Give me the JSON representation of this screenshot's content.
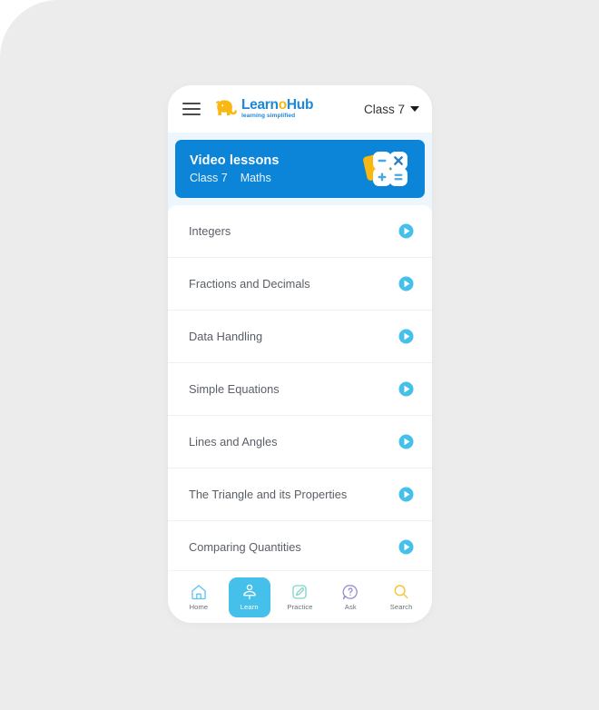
{
  "app": {
    "logo_main_prefix": "Learn",
    "logo_main_accent": "o",
    "logo_main_suffix": "Hub",
    "logo_tagline": "learning simplified",
    "brand_blue": "#1e88d8",
    "brand_yellow": "#f9b811"
  },
  "topbar": {
    "menu_icon": "hamburger-icon",
    "class_selector_label": "Class 7",
    "caret_icon": "chevron-down-icon"
  },
  "banner": {
    "title": "Video lessons",
    "class_label": "Class 7",
    "subject_label": "Maths",
    "background_color": "#0c84d7",
    "icon_name": "maths-operators-icon",
    "operators": [
      "−",
      "×",
      "+",
      "="
    ]
  },
  "lessons": [
    {
      "title": "Integers",
      "action_icon": "play-icon"
    },
    {
      "title": "Fractions and Decimals",
      "action_icon": "play-icon"
    },
    {
      "title": "Data Handling",
      "action_icon": "play-icon"
    },
    {
      "title": "Simple Equations",
      "action_icon": "play-icon"
    },
    {
      "title": "Lines and Angles",
      "action_icon": "play-icon"
    },
    {
      "title": "The Triangle and its Properties",
      "action_icon": "play-icon"
    },
    {
      "title": "Comparing Quantities",
      "action_icon": "play-icon"
    }
  ],
  "bottom_nav": {
    "active_color": "#45c0ea",
    "items": [
      {
        "label": "Home",
        "icon": "house-icon",
        "color": "#5bc6ef",
        "active": false
      },
      {
        "label": "Learn",
        "icon": "student-desk-icon",
        "color": "#ffffff",
        "active": true
      },
      {
        "label": "Practice",
        "icon": "pencil-note-icon",
        "color": "#7fd4cc",
        "active": false
      },
      {
        "label": "Ask",
        "icon": "question-bubble-icon",
        "color": "#9a8fd0",
        "active": false
      },
      {
        "label": "Search",
        "icon": "magnifier-icon",
        "color": "#f5c43a",
        "active": false
      }
    ]
  }
}
